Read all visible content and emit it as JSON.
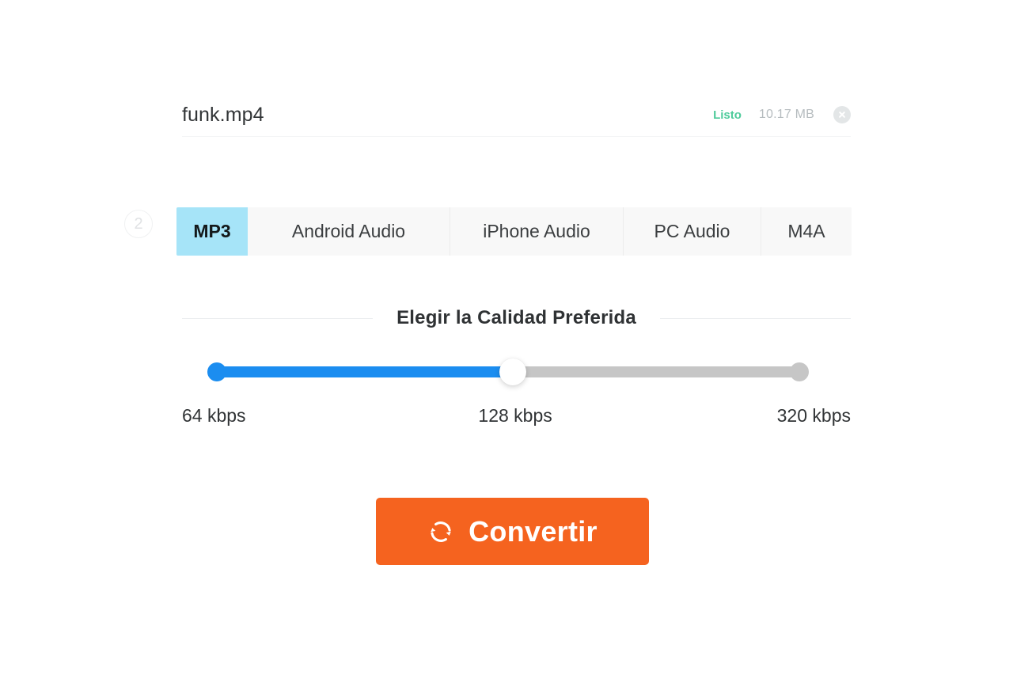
{
  "file": {
    "name": "funk.mp4",
    "status": "Listo",
    "size": "10.17 MB",
    "remove_icon": "close-circle-icon"
  },
  "step": {
    "number": "2"
  },
  "format_tabs": [
    {
      "label": "MP3",
      "active": true
    },
    {
      "label": "Android Audio",
      "active": false
    },
    {
      "label": "iPhone Audio",
      "active": false
    },
    {
      "label": "PC Audio",
      "active": false
    },
    {
      "label": "M4A",
      "active": false
    }
  ],
  "quality": {
    "title": "Elegir la Calidad Preferida",
    "min_label": "64 kbps",
    "mid_label": "128 kbps",
    "max_label": "320 kbps",
    "selected_value": "128 kbps",
    "fill_percent": "50"
  },
  "convert": {
    "label": "Convertir",
    "icon": "refresh-sync-icon"
  },
  "colors": {
    "accent_orange": "#f5631f",
    "slider_blue": "#1b8df0",
    "tab_active_blue": "#a6e4f8",
    "status_green": "#4ecb9b",
    "track_gray": "#c6c6c6"
  }
}
